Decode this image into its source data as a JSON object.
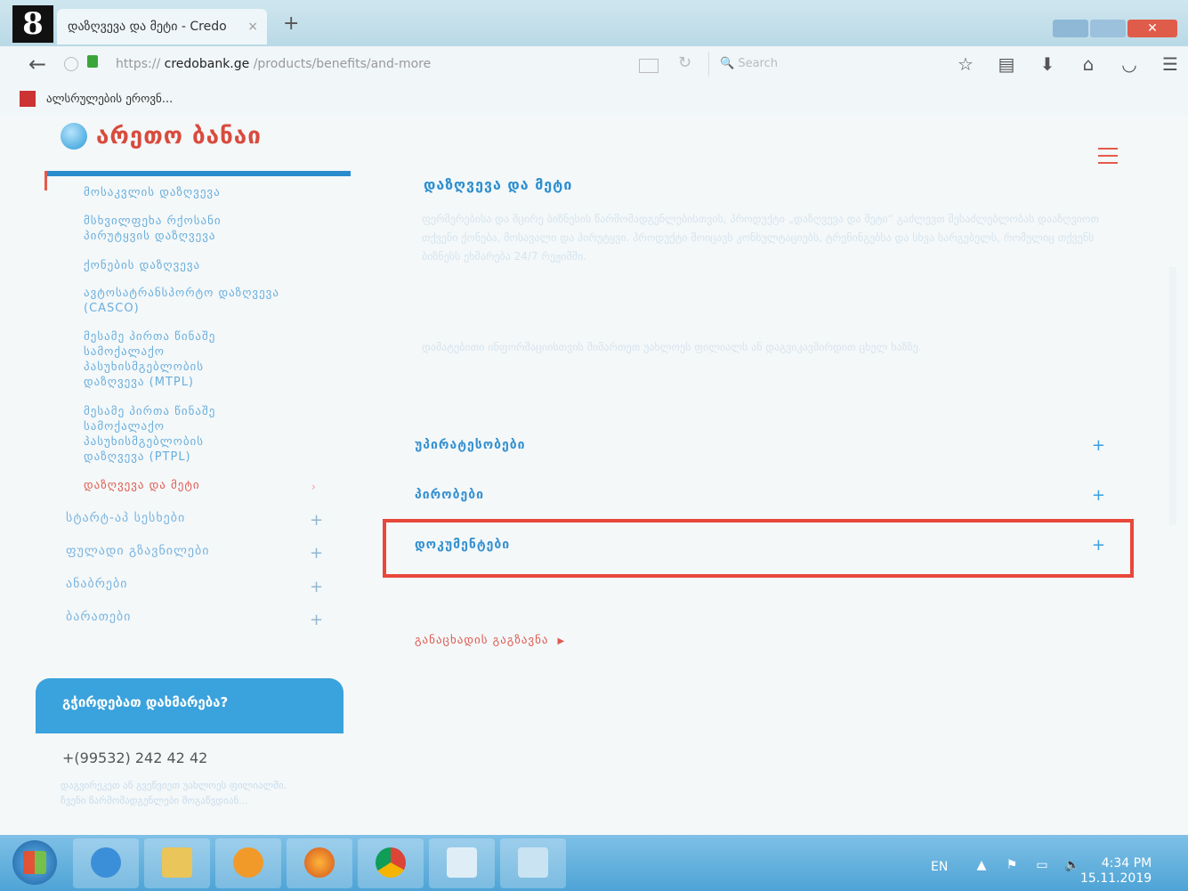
{
  "step_badge": "8",
  "browser": {
    "tab_title": "დაზღვევა და მეტი - Credo",
    "tab_close": "×",
    "new_tab": "+",
    "url_prefix": "https://",
    "url_domain": "credobank.ge",
    "url_path": "/products/benefits/and-more",
    "search_placeholder": "Search",
    "bookmark_label": "ალსრულების ეროვნ..."
  },
  "site": {
    "logo_text": "არეთო ბანაი"
  },
  "sidebar": {
    "sub_items": [
      {
        "label": "მოსაკვლის დაზღვევა",
        "active": false
      },
      {
        "label": "მსხვილფეხა რქოსანი პირუტყვის დაზღვევა",
        "active": false
      },
      {
        "label": "ქონების დაზღვევა",
        "active": false
      },
      {
        "label": "ავტოსატრანსპორტო დაზღვევა (CASCO)",
        "active": false
      },
      {
        "label": "მესამე პირთა წინაშე სამოქალაქო პასუხისმგებლობის დაზღვევა (MTPL)",
        "active": false
      },
      {
        "label": "მესამე პირთა წინაშე სამოქალაქო პასუხისმგებლობის დაზღვევა (PTPL)",
        "active": false
      },
      {
        "label": "დაზღვევა და მეტი",
        "active": true
      }
    ],
    "main_items": [
      {
        "label": "სტარტ-აპ სესხები"
      },
      {
        "label": "ფულადი გზავნილები"
      },
      {
        "label": "ანაბრები"
      },
      {
        "label": "ბარათები"
      }
    ]
  },
  "help": {
    "title": "გჭირდებათ დახმარება?",
    "phone": "+(99532) 242 42 42",
    "text": "დაგვირეკეთ ან გვეწვიეთ უახლოეს ფილიალში. ჩვენი წარმომადგენლები მოგაწვდიან..."
  },
  "main": {
    "title": "დაზღვევა და მეტი",
    "para1": "ფერმერებისა და მცირე ბიზნესის წარმომადგენლებისთვის, პროდუქტი „დაზღვევა და მეტი“ გაძლევთ შესაძლებლობას დააზღვიოთ თქვენი ქონება, მოსავალი და პირუტყვი. პროდუქტი მოიცავს კონსულტაციებს, ტრენინგებსა და სხვა სარგებელს, რომელიც თქვენს ბიზნესს ეხმარება 24/7 რეჟიმში.",
    "para2": "დამატებითი ინფორმაციისთვის მიმართეთ უახლოეს ფილიალს ან დაგვიკავშირდით ცხელ ხაზზე.",
    "accordions": [
      {
        "label": "უპირატესობები",
        "icon": "+"
      },
      {
        "label": "პირობები",
        "icon": "+"
      },
      {
        "label": "დოკუმენტები",
        "icon": "+"
      }
    ],
    "apply_link": "განაცხადის გაგზავნა"
  },
  "taskbar": {
    "lang": "EN",
    "time": "4:34 PM",
    "date": "15.11.2019"
  }
}
